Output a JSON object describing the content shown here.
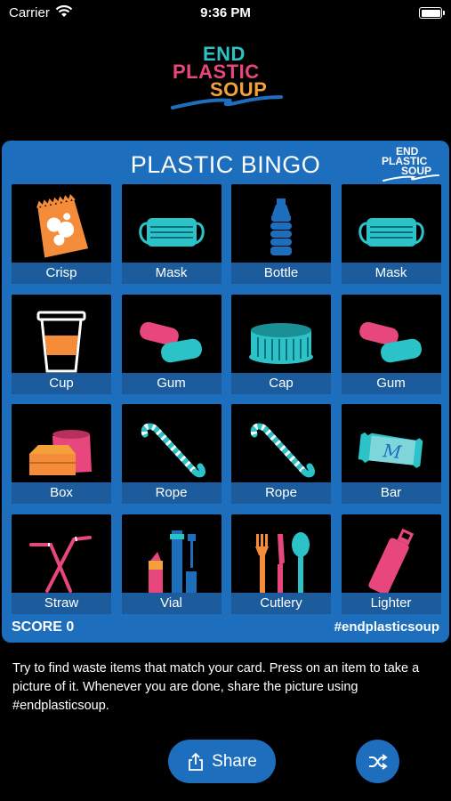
{
  "status_bar": {
    "carrier": "Carrier",
    "time": "9:36 PM"
  },
  "logo": {
    "line1": "END",
    "line2": "PLASTIC",
    "line3": "SOUP"
  },
  "card": {
    "title": "PLASTIC BINGO",
    "mini_logo": {
      "line1": "END",
      "line2": "PLASTIC",
      "line3": "SOUP"
    },
    "items": [
      {
        "label": "Crisp",
        "icon": "crisp-bag-icon"
      },
      {
        "label": "Mask",
        "icon": "face-mask-icon"
      },
      {
        "label": "Bottle",
        "icon": "bottle-icon"
      },
      {
        "label": "Mask",
        "icon": "face-mask-icon"
      },
      {
        "label": "Cup",
        "icon": "coffee-cup-icon"
      },
      {
        "label": "Gum",
        "icon": "chewing-gum-icon"
      },
      {
        "label": "Cap",
        "icon": "bottle-cap-icon"
      },
      {
        "label": "Gum",
        "icon": "chewing-gum-icon"
      },
      {
        "label": "Box",
        "icon": "takeaway-box-icon"
      },
      {
        "label": "Rope",
        "icon": "rope-icon"
      },
      {
        "label": "Rope",
        "icon": "rope-icon"
      },
      {
        "label": "Bar",
        "icon": "candy-bar-wrapper-icon"
      },
      {
        "label": "Straw",
        "icon": "straws-icon"
      },
      {
        "label": "Vial",
        "icon": "cosmetics-vials-icon"
      },
      {
        "label": "Cutlery",
        "icon": "cutlery-icon"
      },
      {
        "label": "Lighter",
        "icon": "lighter-icon"
      }
    ],
    "score_text": "SCORE 0",
    "hashtag": "#endplasticsoup"
  },
  "description": "Try to find waste items that match your card. Press on an item to take a picture of it. Whenever you are done, share the picture using #endplasticsoup.",
  "buttons": {
    "share_label": "Share",
    "share_icon": "share-icon",
    "shuffle_icon": "shuffle-icon"
  },
  "colors": {
    "card_blue": "#1d6fbe",
    "label_blue": "#1c5c9c",
    "teal": "#2bc3c8",
    "pink": "#e8477d",
    "orange": "#f5a13a"
  }
}
